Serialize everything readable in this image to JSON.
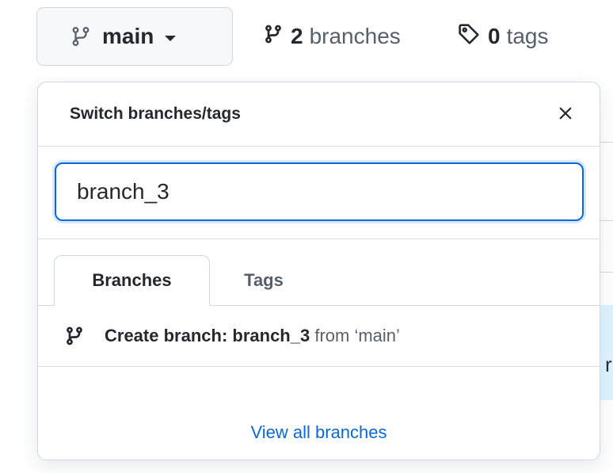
{
  "top_bar": {
    "branch_button": {
      "label": "main",
      "icon": "git-branch-icon"
    },
    "branches_count": {
      "count": "2",
      "label": "branches",
      "icon": "git-branch-icon"
    },
    "tags_count": {
      "count": "0",
      "label": "tags",
      "icon": "tag-icon"
    }
  },
  "dropdown": {
    "title": "Switch branches/tags",
    "close_icon": "close-icon",
    "filter": {
      "value": "branch_3"
    },
    "tabs": [
      {
        "label": "Branches",
        "selected": true
      },
      {
        "label": "Tags",
        "selected": false
      }
    ],
    "create_branch": {
      "icon": "git-branch-icon",
      "prefix": "Create branch: ",
      "branch_name": "branch_3",
      "suffix": " from ‘main’"
    },
    "view_all_label": "View all branches"
  },
  "colors": {
    "accent": "#0969da",
    "border": "#d0d7de",
    "button_bg": "#f6f8fa",
    "text": "#24292f",
    "muted_text": "#57606a",
    "highlight_bg": "#ddf4ff"
  },
  "background": {
    "partial_text": "r"
  }
}
